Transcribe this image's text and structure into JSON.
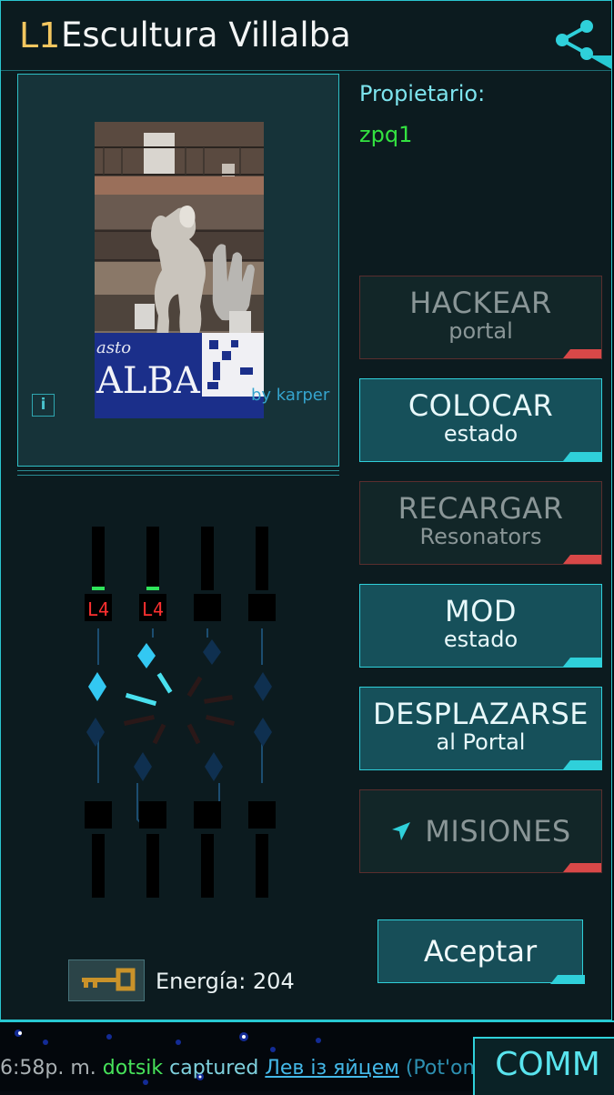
{
  "portal": {
    "level": "L1",
    "name": "Escultura Villalba",
    "owner_label": "Propietario:",
    "owner": "zpq1",
    "photo_credit": "by karper",
    "photo_sign_text": "ALBA",
    "photo_sign_top": "asto"
  },
  "icons": {
    "share": "share-icon",
    "info": "info-icon",
    "key": "key-icon",
    "missions": "mission-arrow-icon"
  },
  "actions": [
    {
      "main": "HACKEAR",
      "sub": "portal",
      "state": "disabled"
    },
    {
      "main": "COLOCAR",
      "sub": "estado",
      "state": "active"
    },
    {
      "main": "RECARGAR",
      "sub": "Resonators",
      "state": "disabled"
    },
    {
      "main": "MOD",
      "sub": "estado",
      "state": "active"
    },
    {
      "main": "DESPLAZARSE",
      "sub": "al Portal",
      "state": "active"
    },
    {
      "main": "MISIONES",
      "sub": "",
      "state": "disabled"
    }
  ],
  "accept_label": "Aceptar",
  "energy_text": "Energía: 204",
  "resonators": {
    "top_levels": [
      "L4",
      "L4",
      "",
      ""
    ],
    "top_charge": [
      1,
      1,
      0,
      0
    ],
    "bottom_levels": [
      "",
      "",
      "",
      ""
    ]
  },
  "comm": {
    "time": "6:58p. m.",
    "player": "dotsik",
    "verb": "captured",
    "portal": "Лев із яйцем",
    "rest": "(Pot'om)in",
    "tab_label": "COMM"
  },
  "colors": {
    "accent": "#2fd0da",
    "level_gold": "#f2c65f",
    "owner_green": "#33e240",
    "disabled_red": "#d84848",
    "resonator_level_red": "#ff3030"
  }
}
